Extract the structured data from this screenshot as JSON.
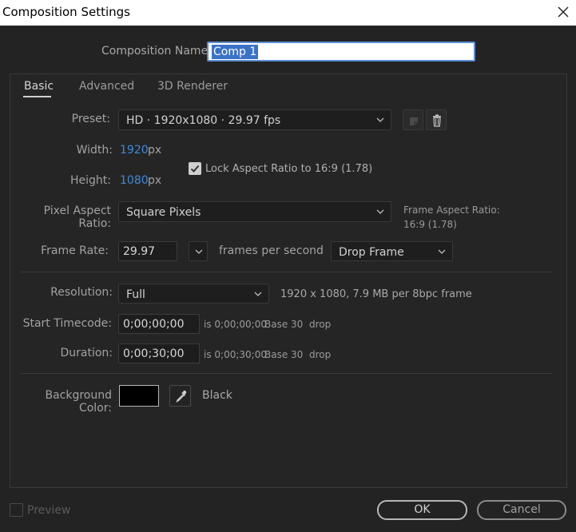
{
  "window": {
    "title": "Composition Settings"
  },
  "composition": {
    "name_label": "Composition Name:",
    "name_value": "Comp 1"
  },
  "tabs": [
    {
      "label": "Basic",
      "active": true
    },
    {
      "label": "Advanced",
      "active": false
    },
    {
      "label": "3D Renderer",
      "active": false
    }
  ],
  "basic": {
    "preset_label": "Preset:",
    "preset_value": "HD · 1920x1080 · 29.97 fps",
    "width_label": "Width:",
    "width_value": "1920",
    "width_unit": "px",
    "height_label": "Height:",
    "height_value": "1080",
    "height_unit": "px",
    "lock_label": "Lock Aspect Ratio to 16:9 (1.78)",
    "lock_checked": true,
    "par_label": "Pixel Aspect Ratio:",
    "par_value": "Square Pixels",
    "far_label": "Frame Aspect Ratio:",
    "far_value": "16:9 (1.78)",
    "framerate_label": "Frame Rate:",
    "framerate_value": "29.97",
    "framerate_unit": "frames per second",
    "dropframe_value": "Drop Frame",
    "resolution_label": "Resolution:",
    "resolution_value": "Full",
    "resolution_info": "1920 x 1080, 7.9 MB per 8bpc frame",
    "start_label": "Start Timecode:",
    "start_value": "0;00;00;00",
    "start_info": "is 0;00;00;00",
    "start_base": "Base 30",
    "start_drop": "drop",
    "duration_label": "Duration:",
    "duration_value": "0;00;30;00",
    "duration_info": "is 0;00;30;00",
    "duration_base": "Base 30",
    "duration_drop": "drop",
    "bg_label": "Background Color:",
    "bg_color": "#000000",
    "bg_name": "Black"
  },
  "footer": {
    "preview_label": "Preview",
    "preview_checked": false,
    "ok_label": "OK",
    "cancel_label": "Cancel"
  },
  "icons": [
    "close-icon",
    "new-preset-icon",
    "trash-icon",
    "chevron-down-icon",
    "checkmark-icon",
    "eyedropper-icon"
  ],
  "colors": {
    "accent": "#3f8bdc",
    "selection": "#3a72c8",
    "background": "#232323"
  }
}
